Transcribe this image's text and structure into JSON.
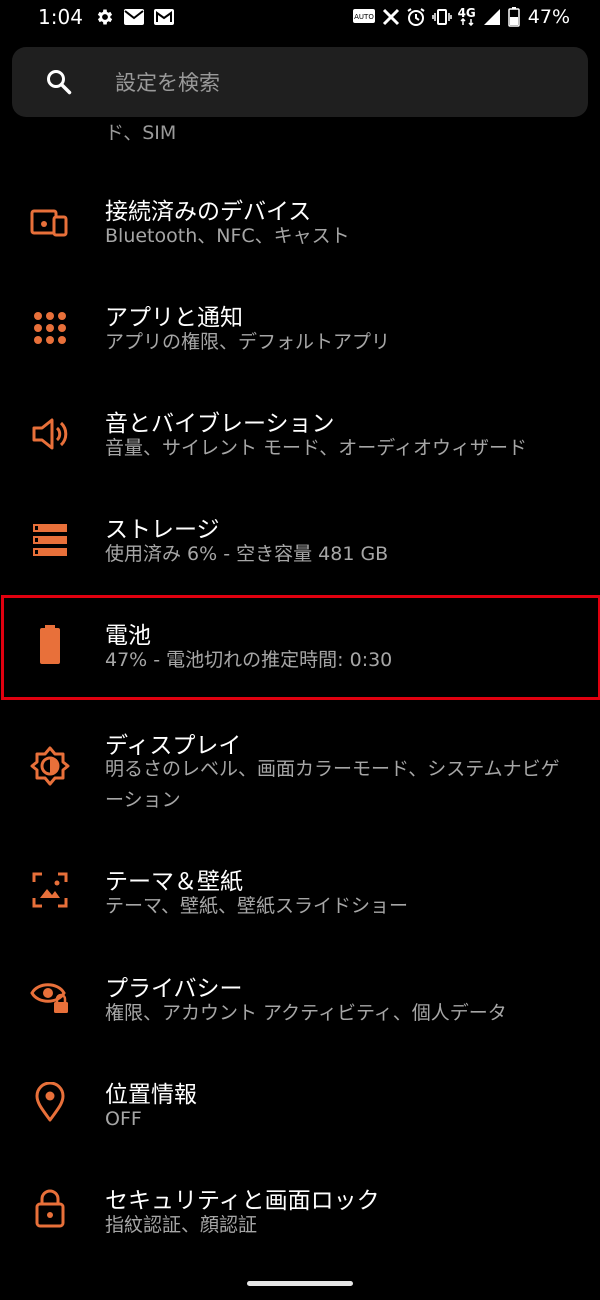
{
  "status_bar": {
    "time": "1:04",
    "battery_percent": "47%",
    "network": "4G",
    "icons_left": [
      "gear-icon",
      "mail-icon",
      "gmail-icon"
    ],
    "icons_right": [
      "auto-icon",
      "x-icon",
      "alarm-icon",
      "vibrate-icon",
      "network-4g-icon",
      "signal-icon",
      "battery-icon"
    ]
  },
  "search": {
    "placeholder": "設定を検索"
  },
  "partial_item": {
    "summary": "ド、SIM"
  },
  "settings": [
    {
      "title": "接続済みのデバイス",
      "summary": "Bluetooth、NFC、キャスト",
      "icon": "connected-devices-icon"
    },
    {
      "title": "アプリと通知",
      "summary": "アプリの権限、デフォルトアプリ",
      "icon": "apps-grid-icon"
    },
    {
      "title": "音とバイブレーション",
      "summary": "音量、サイレント モード、オーディオウィザード",
      "icon": "volume-icon"
    },
    {
      "title": "ストレージ",
      "summary": "使用済み 6% - 空き容量 481 GB",
      "icon": "storage-icon"
    },
    {
      "title": "電池",
      "summary": "47% - 電池切れの推定時間: 0:30",
      "icon": "battery-icon"
    },
    {
      "title": "ディスプレイ",
      "summary": "明るさのレベル、画面カラーモード、システムナビゲーション",
      "icon": "brightness-icon"
    },
    {
      "title": "テーマ＆壁紙",
      "summary": "テーマ、壁紙、壁紙スライドショー",
      "icon": "wallpaper-icon"
    },
    {
      "title": "プライバシー",
      "summary": "権限、アカウント アクティビティ、個人データ",
      "icon": "privacy-eye-icon"
    },
    {
      "title": "位置情報",
      "summary": "OFF",
      "icon": "location-pin-icon"
    },
    {
      "title": "セキュリティと画面ロック",
      "summary": "指紋認証、顔認証",
      "icon": "lock-icon"
    }
  ],
  "colors": {
    "accent": "#e8703a",
    "highlight": "#e1000f",
    "background": "#000000",
    "search_bg": "#1f1f1f"
  }
}
